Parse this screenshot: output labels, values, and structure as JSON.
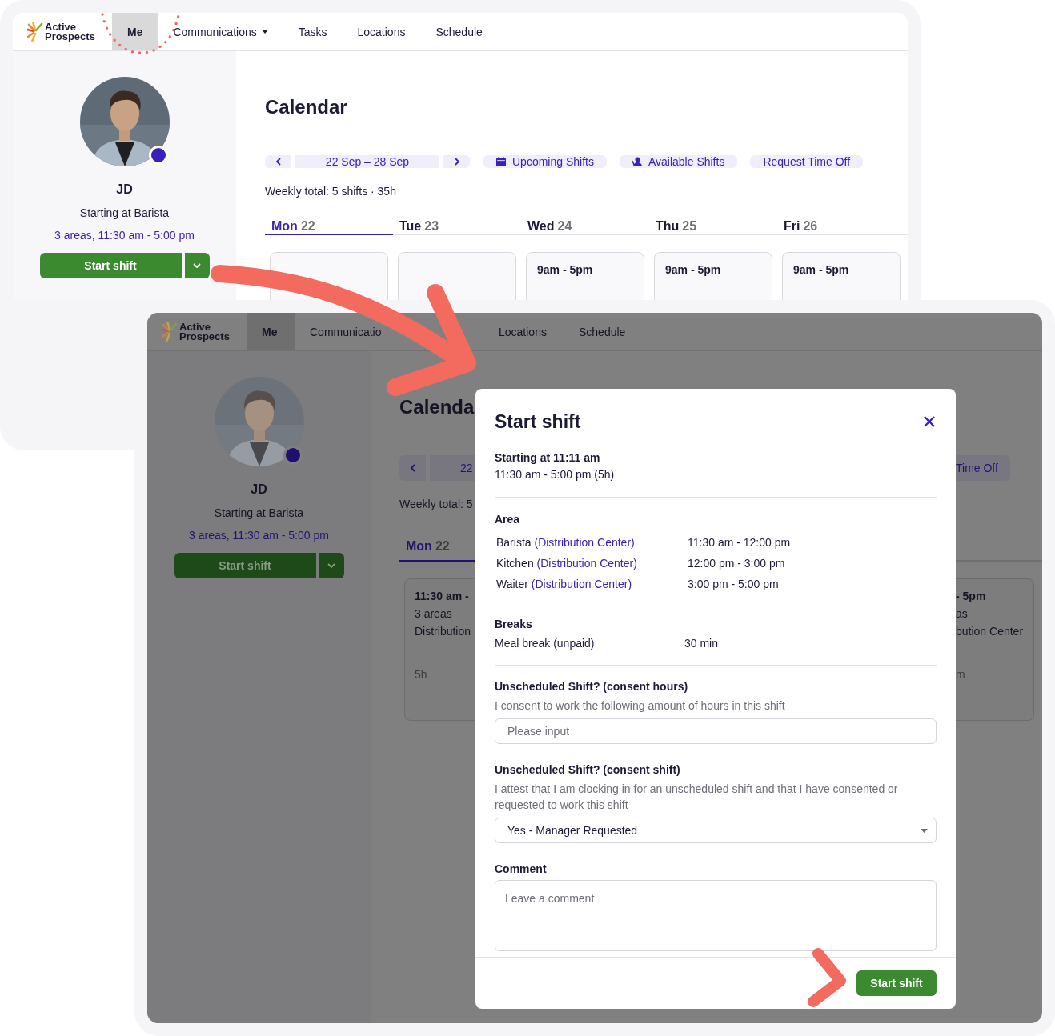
{
  "top_screen": {
    "nav": {
      "logo": [
        "Active",
        "Prospects"
      ],
      "items": [
        {
          "label": "Me",
          "selected": true,
          "dropdown": false
        },
        {
          "label": "Communications",
          "selected": false,
          "dropdown": true
        },
        {
          "label": "Tasks",
          "selected": false,
          "dropdown": false
        },
        {
          "label": "Locations",
          "selected": false,
          "dropdown": false
        },
        {
          "label": "Schedule",
          "selected": false,
          "dropdown": false
        }
      ]
    },
    "profile": {
      "name": "JD",
      "status": "Starting at Barista",
      "shift": "3 areas, 11:30 am - 5:00 pm",
      "button": "Start shift"
    },
    "calendar": {
      "title": "Calendar",
      "range": "22 Sep – 28 Sep",
      "actions": [
        {
          "label": "Upcoming Shifts",
          "kind": "calendar"
        },
        {
          "label": "Available Shifts",
          "kind": "person"
        },
        {
          "label": "Request Time Off",
          "kind": "plain"
        }
      ],
      "summary": "Weekly total: 5 shifts · 35h",
      "days": [
        {
          "day": "Mon",
          "date": "22",
          "selected": true
        },
        {
          "day": "Tue",
          "date": "23",
          "selected": false
        },
        {
          "day": "Wed",
          "date": "24",
          "selected": false,
          "shift": "9am - 5pm"
        },
        {
          "day": "Thu",
          "date": "25",
          "selected": false,
          "shift": "9am - 5pm"
        },
        {
          "day": "Fri",
          "date": "26",
          "selected": false,
          "shift": "9am - 5pm"
        }
      ]
    }
  },
  "bottom_screen": {
    "nav": {
      "logo": [
        "Active",
        "Prospects"
      ],
      "items": [
        {
          "label": "Me",
          "selected": true
        },
        {
          "label": "Communicatio",
          "selected": false
        },
        {
          "label": "Locations",
          "selected": false
        },
        {
          "label": "Schedule",
          "selected": false
        }
      ]
    },
    "profile": {
      "name": "JD",
      "status": "Starting at Barista",
      "shift": "3 areas, 11:30 am - 5:00 pm",
      "button": "Start shift"
    },
    "left_of_dialog": {
      "title": "Calenda",
      "range": "22",
      "summary": "Weekly total: 5",
      "tab": {
        "day": "Mon",
        "date": "22",
        "selected": true
      },
      "card": {
        "time": "11:30 am -",
        "areas": "3 areas",
        "place": "Distribution",
        "duration": "5h"
      }
    },
    "right_of_dialog": {
      "action": "Time Off",
      "card": {
        "time": "- 5pm",
        "areas": "as",
        "place": "bution Center",
        "duration": "m"
      }
    },
    "dialog": {
      "title": "Start shift",
      "start": "Starting at 11:11 am",
      "range": "11:30 am - 5:00 pm (5h)",
      "area": {
        "heading": "Area",
        "rows": [
          {
            "role": "Barista",
            "location": "(Distribution Center)",
            "time": "11:30 am - 12:00 pm"
          },
          {
            "role": "Kitchen",
            "location": "(Distribution Center)",
            "time": "12:00 pm - 3:00 pm"
          },
          {
            "role": "Waiter",
            "location": "(Distribution Center)",
            "time": "3:00 pm - 5:00 pm"
          }
        ]
      },
      "breaks": {
        "heading": "Breaks",
        "rows": [
          {
            "name": "Meal break (unpaid)",
            "duration": "30 min"
          }
        ]
      },
      "fields": [
        {
          "kind": "input",
          "label": "Unscheduled Shift? (consent hours)",
          "help": "I consent to work the following amount of hours in this shift",
          "placeholder": "Please input"
        },
        {
          "kind": "select",
          "label": "Unscheduled Shift? (consent shift)",
          "help": "I attest that I am clocking in for an unscheduled shift and that I have consented or requested to work this shift",
          "value": "Yes - Manager Requested"
        },
        {
          "kind": "textarea",
          "label": "Comment",
          "placeholder": "Leave a comment"
        }
      ],
      "submit": "Start shift"
    }
  }
}
